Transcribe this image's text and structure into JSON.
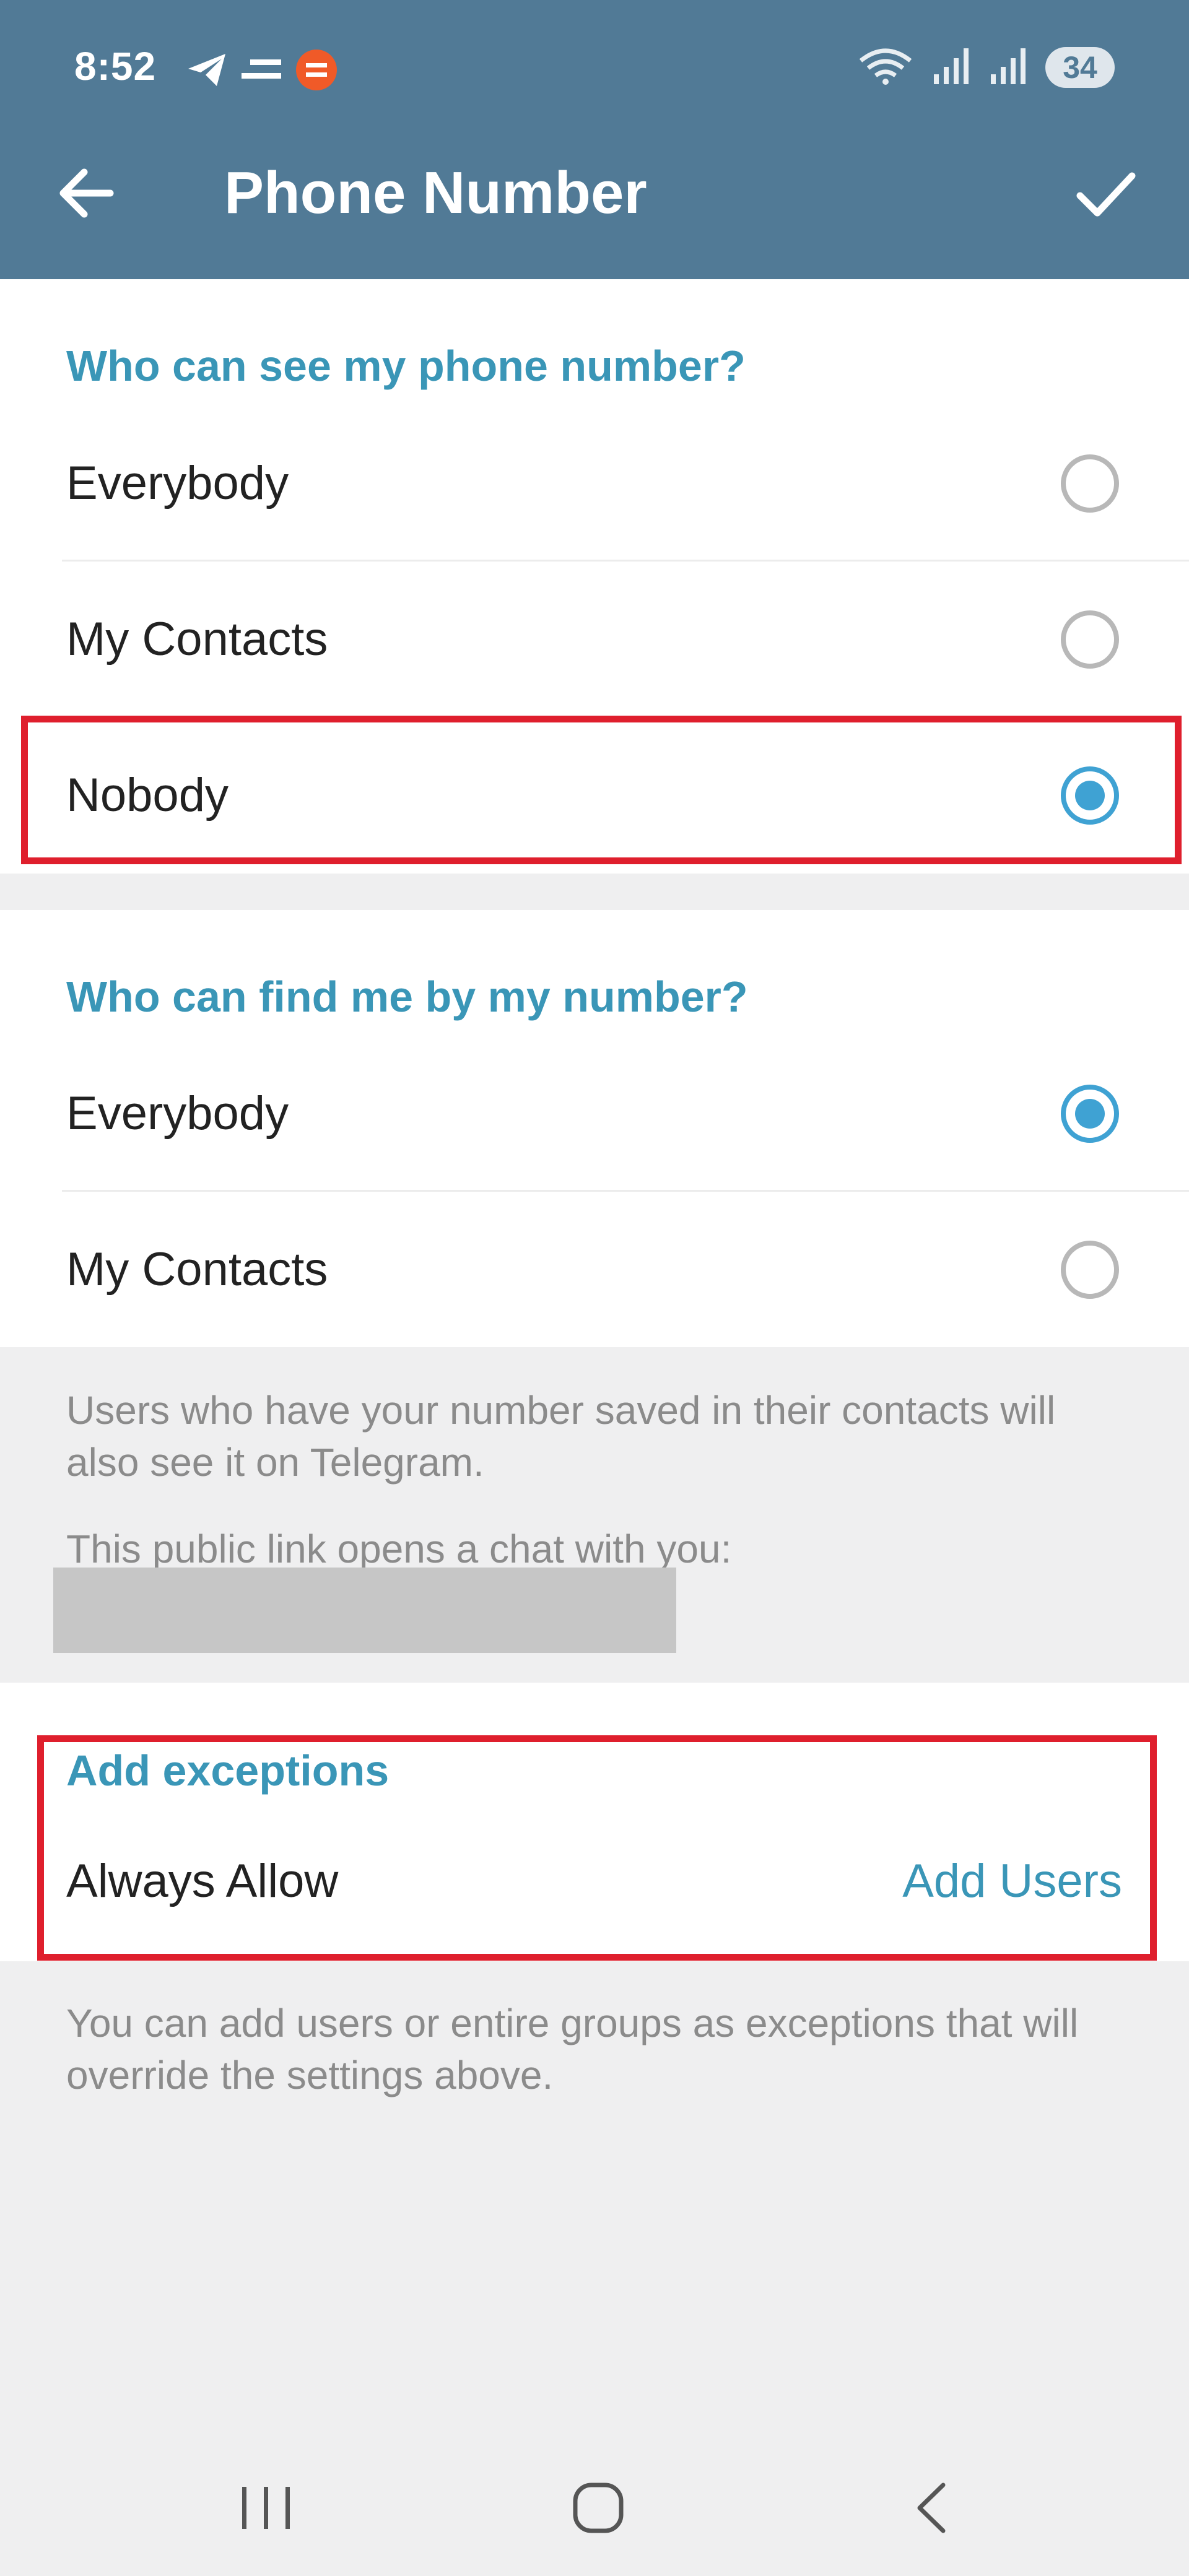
{
  "status_bar": {
    "time": "8:52",
    "battery": "34",
    "left_icons": [
      "telegram-send-icon",
      "menu-lines-icon",
      "notification-app-icon"
    ],
    "right_icons": [
      "wifi-icon",
      "signal-icon",
      "signal-icon"
    ]
  },
  "app_bar": {
    "title": "Phone Number",
    "back_icon": "arrow-left-icon",
    "confirm_icon": "checkmark-icon",
    "background": "#517a96"
  },
  "see_number": {
    "header": "Who can see my phone number?",
    "options": [
      {
        "label": "Everybody",
        "selected": false
      },
      {
        "label": "My Contacts",
        "selected": false
      },
      {
        "label": "Nobody",
        "selected": true
      }
    ]
  },
  "find_by_number": {
    "header": "Who can find me by my number?",
    "options": [
      {
        "label": "Everybody",
        "selected": true
      },
      {
        "label": "My Contacts",
        "selected": false
      }
    ],
    "info": "Users who have your number saved in their contacts will also see it on Telegram.",
    "link_text": "This public link opens a chat with you:"
  },
  "exceptions": {
    "header": "Add exceptions",
    "always_allow": "Always Allow",
    "add_users": "Add Users",
    "footer": "You can add users or entire groups as exceptions that will override the settings above."
  },
  "nav_bar": {
    "recents_icon": "recents-icon",
    "home_icon": "home-icon",
    "back_icon": "nav-back-icon"
  },
  "colors": {
    "accent": "#3a96b7",
    "radio_selected": "#3fa2d3",
    "highlight": "#df1f2d"
  }
}
